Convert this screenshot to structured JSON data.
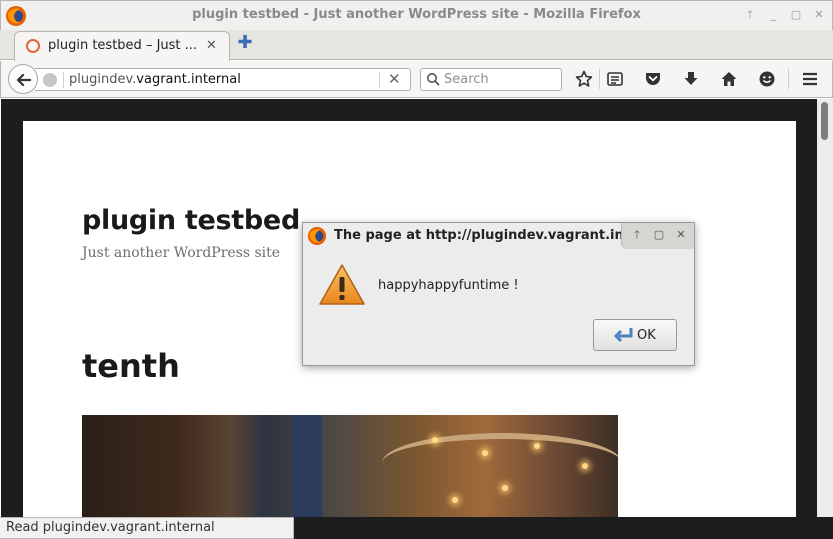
{
  "window": {
    "title": "plugin testbed - Just another WordPress site - Mozilla Firefox",
    "controls": [
      "up-arrow-icon",
      "minimize-icon",
      "maximize-icon",
      "close-icon"
    ]
  },
  "tabs": [
    {
      "label": "plugin testbed – Just ...",
      "icon": "loading-spinner-icon",
      "close": "✕"
    }
  ],
  "navbar": {
    "url_prefix": "plugindev.",
    "url_host": "vagrant.internal",
    "search_placeholder": "Search",
    "icons": [
      "bookmark-star-icon",
      "reading-list-icon",
      "pocket-icon",
      "download-icon",
      "home-icon",
      "hello-icon",
      "menu-icon"
    ]
  },
  "page": {
    "site_title": "plugin testbed",
    "tagline": "Just another WordPress site",
    "post_title": "tenth"
  },
  "status": {
    "text": "Read plugindev.vagrant.internal"
  },
  "dialog": {
    "title": "The page at http://plugindev.vagrant.internal says:",
    "message": "happyhappyfuntime !",
    "ok_label": "OK"
  },
  "colors": {
    "accent": "#3b6db4",
    "page_bg": "#1d1d1d",
    "warning": "#f0a030"
  }
}
